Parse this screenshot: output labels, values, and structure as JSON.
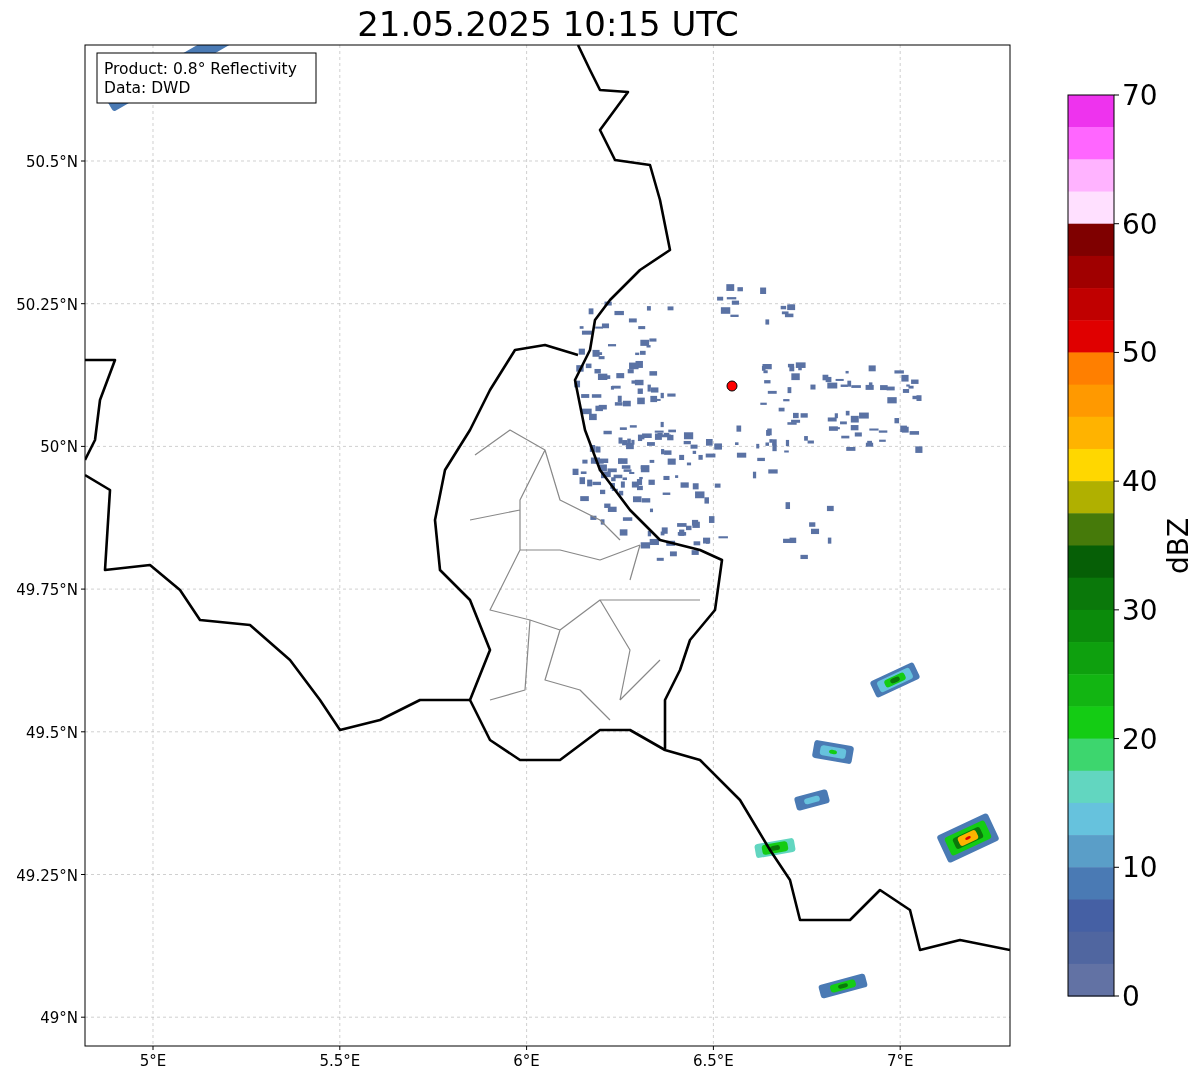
{
  "title": "21.05.2025 10:15 UTC",
  "map": {
    "x_ticks": [
      "5°E",
      "5.5°E",
      "6°E",
      "6.5°E",
      "7°E"
    ],
    "y_ticks": [
      "50.5°N",
      "50.25°N",
      "50°N",
      "49.75°N",
      "49.5°N",
      "49.25°N",
      "49°N"
    ],
    "legend": [
      "Product: 0.8° Reflectivity",
      "Data: DWD"
    ]
  },
  "colorbar": {
    "label": "dBZ",
    "ticks": [
      "70",
      "60",
      "50",
      "40",
      "30",
      "20",
      "10",
      "0"
    ],
    "segments": [
      {
        "color": "#ee33ee"
      },
      {
        "color": "#ff66ff"
      },
      {
        "color": "#ffb3ff"
      },
      {
        "color": "#ffe0ff"
      },
      {
        "color": "#7f0000"
      },
      {
        "color": "#a00000"
      },
      {
        "color": "#c00000"
      },
      {
        "color": "#e00000"
      },
      {
        "color": "#ff7f00"
      },
      {
        "color": "#ff9900"
      },
      {
        "color": "#ffb300"
      },
      {
        "color": "#ffd700"
      },
      {
        "color": "#b0b000"
      },
      {
        "color": "#467a0a"
      },
      {
        "color": "#065f06"
      },
      {
        "color": "#0a780a"
      },
      {
        "color": "#0b8b0b"
      },
      {
        "color": "#0ea00e"
      },
      {
        "color": "#12b512"
      },
      {
        "color": "#14cc14"
      },
      {
        "color": "#3dd66e"
      },
      {
        "color": "#62d6c0"
      },
      {
        "color": "#66c2dd"
      },
      {
        "color": "#5a9ec8"
      },
      {
        "color": "#4a7ab4"
      },
      {
        "color": "#4560a4"
      },
      {
        "color": "#5066a0"
      },
      {
        "color": "#6272a4"
      }
    ]
  }
}
